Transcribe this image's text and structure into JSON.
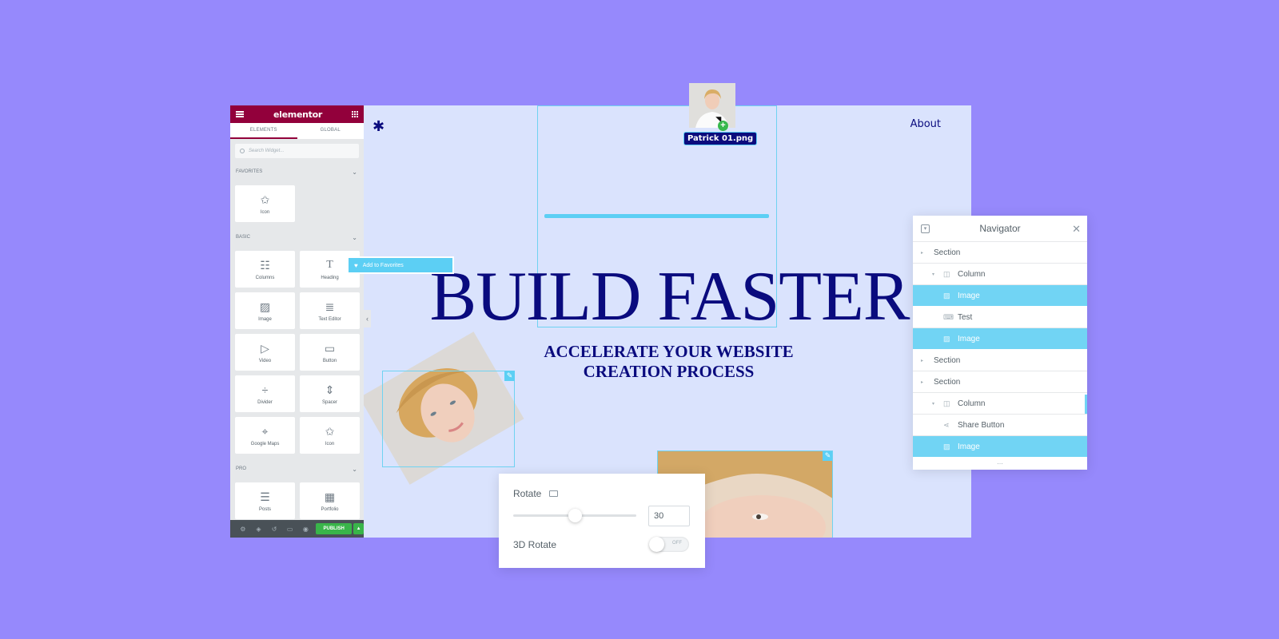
{
  "page": {
    "logo_icon": "asterisk-logo",
    "nav_link": "About",
    "hero_title": "BUILD FASTER",
    "hero_subtitle_line1": "ACCELERATE YOUR WEBSITE",
    "hero_subtitle_line2": "CREATION PROCESS"
  },
  "drag": {
    "file_label": "Patrick 01.png",
    "plus_icon": "+"
  },
  "panel": {
    "brand": "elementor",
    "tabs": [
      {
        "label": "ELEMENTS",
        "active": true
      },
      {
        "label": "GLOBAL",
        "active": false
      }
    ],
    "search_placeholder": "Search Widget...",
    "categories": {
      "favorites": {
        "label": "FAVORITES",
        "items": [
          {
            "label": "Icon",
            "icon": "star-icon"
          }
        ]
      },
      "basic": {
        "label": "BASIC",
        "items": [
          {
            "label": "Columns",
            "icon": "columns-icon"
          },
          {
            "label": "Heading",
            "icon": "heading-icon"
          },
          {
            "label": "Image",
            "icon": "image-icon"
          },
          {
            "label": "Text Editor",
            "icon": "text-editor-icon"
          },
          {
            "label": "Video",
            "icon": "video-icon"
          },
          {
            "label": "Button",
            "icon": "button-icon"
          },
          {
            "label": "Divider",
            "icon": "divider-icon"
          },
          {
            "label": "Spacer",
            "icon": "spacer-icon"
          },
          {
            "label": "Google Maps",
            "icon": "map-icon"
          },
          {
            "label": "Icon",
            "icon": "star-icon"
          }
        ]
      },
      "pro": {
        "label": "PRO",
        "items": [
          {
            "label": "Posts",
            "icon": "posts-icon"
          },
          {
            "label": "Portfolio",
            "icon": "portfolio-icon"
          }
        ]
      }
    },
    "footer": {
      "publish_label": "PUBLISH"
    },
    "favorites_tooltip": "Add to Favorites"
  },
  "navigator": {
    "title": "Navigator",
    "rows": [
      {
        "label": "Section",
        "level": 0,
        "type": "section",
        "selected": false
      },
      {
        "label": "Column",
        "level": 1,
        "type": "column",
        "selected": false
      },
      {
        "label": "Image",
        "level": 2,
        "type": "image",
        "selected": true
      },
      {
        "label": "Test",
        "level": 2,
        "type": "button",
        "selected": false
      },
      {
        "label": "Image",
        "level": 2,
        "type": "image",
        "selected": true
      },
      {
        "label": "Section",
        "level": 0,
        "type": "section",
        "selected": false
      },
      {
        "label": "Section",
        "level": 0,
        "type": "section",
        "selected": false
      },
      {
        "label": "Column",
        "level": 1,
        "type": "column",
        "selected": false
      },
      {
        "label": "Share Button",
        "level": 2,
        "type": "share",
        "selected": false
      },
      {
        "label": "Image",
        "level": 2,
        "type": "image",
        "selected": true
      }
    ],
    "more": "..."
  },
  "rotate_control": {
    "label": "Rotate",
    "value": "30",
    "slider_fraction": 0.5,
    "label_3d": "3D Rotate",
    "toggle_state": "OFF"
  },
  "colors": {
    "background": "#9689fc",
    "canvas": "#dae3fd",
    "heading": "#0a0b7e",
    "elementor_brand": "#92003b",
    "selection": "#71d4f4",
    "publish": "#39b54a"
  }
}
